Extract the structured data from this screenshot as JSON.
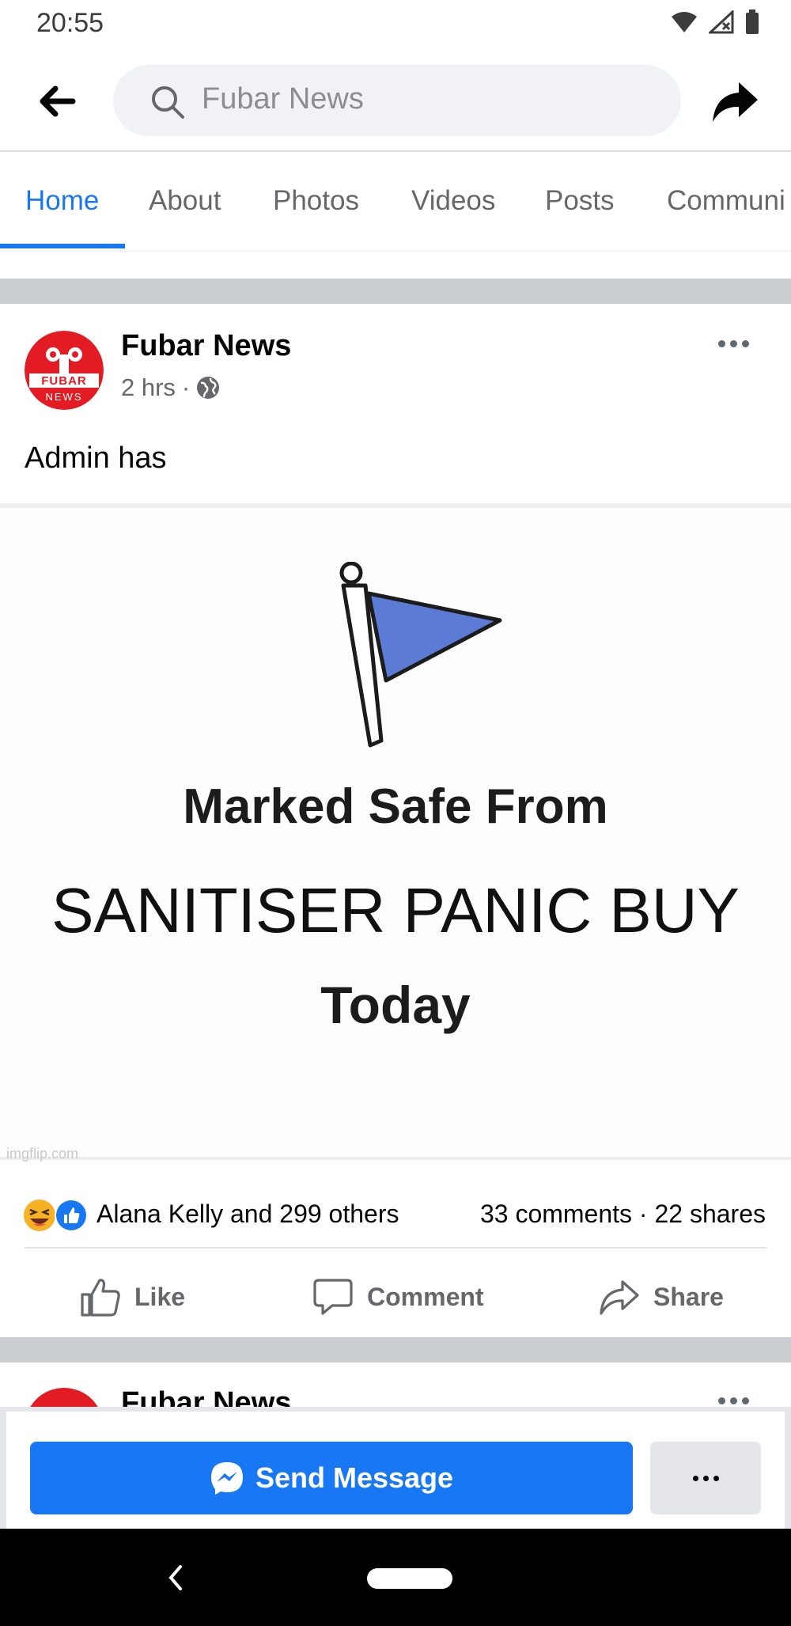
{
  "status_bar": {
    "time": "20:55"
  },
  "search": {
    "query": "Fubar News"
  },
  "tabs": [
    {
      "label": "Home",
      "active": true
    },
    {
      "label": "About"
    },
    {
      "label": "Photos"
    },
    {
      "label": "Videos"
    },
    {
      "label": "Posts"
    },
    {
      "label": "Communi"
    }
  ],
  "post": {
    "page_name": "Fubar News",
    "time": "2 hrs",
    "text": "Admin has",
    "avatar_text": {
      "top": "FUBAR",
      "bottom": "NEWS"
    },
    "image": {
      "line1": "Marked Safe From",
      "line2": "SANITISER PANIC BUY",
      "line3": "Today",
      "watermark": "imgflip.com"
    },
    "reactors": "Alana Kelly and 299 others",
    "comments": "33 comments",
    "shares": "22 shares",
    "actions": {
      "like": "Like",
      "comment": "Comment",
      "share": "Share"
    }
  },
  "next_post": {
    "page_name": "Fubar News"
  },
  "bottom_bar": {
    "send_message": "Send Message"
  },
  "colors": {
    "accent": "#1877f2",
    "brand_red": "#e31b23",
    "flag_blue": "#5b7bd5"
  }
}
